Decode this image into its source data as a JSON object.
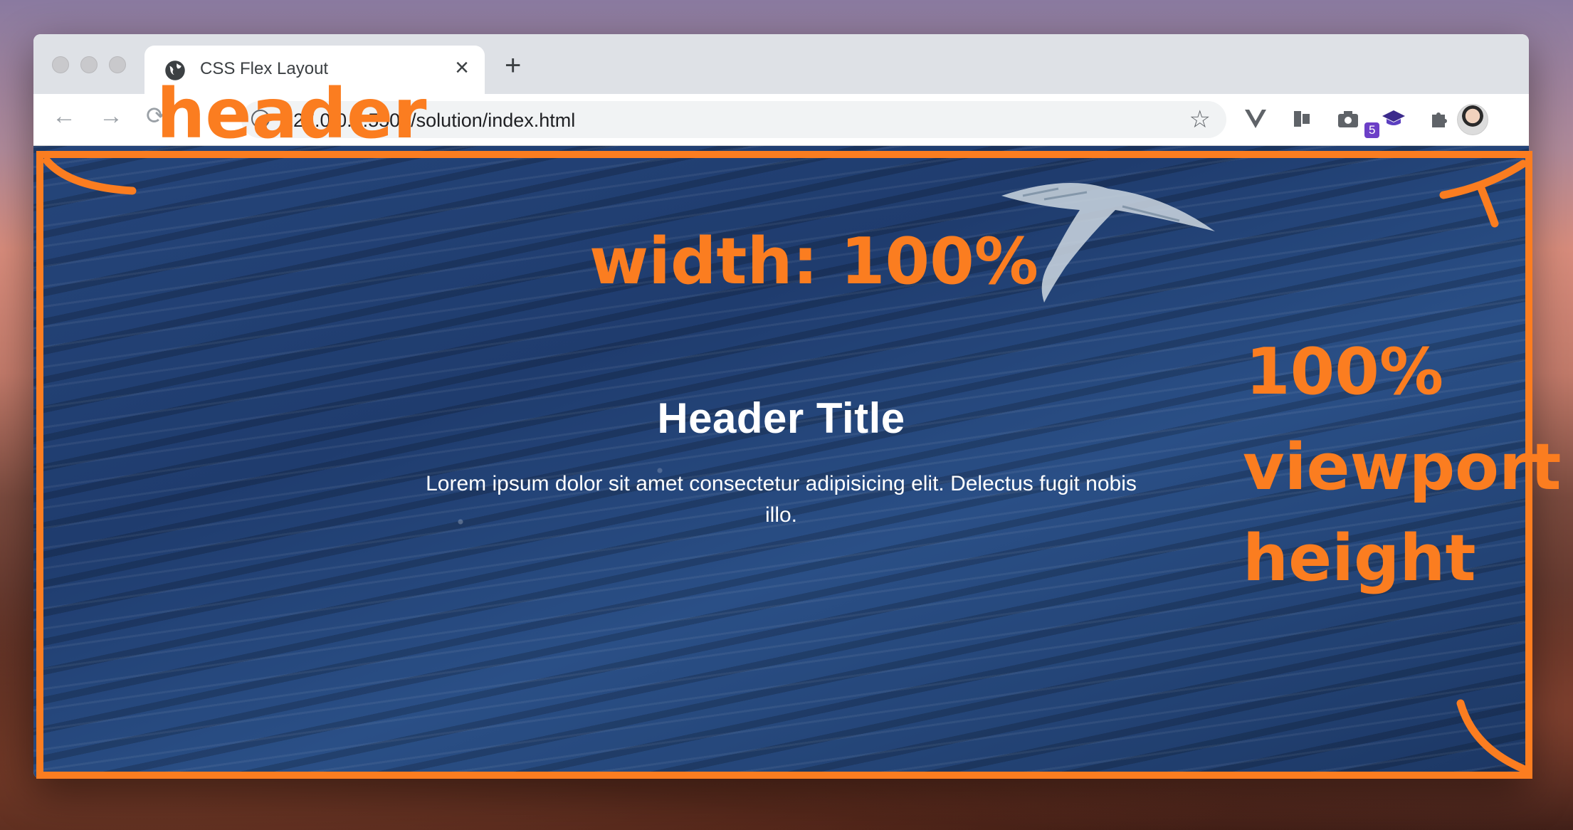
{
  "browser": {
    "tab_title": "CSS Flex Layout",
    "tab_close": "×",
    "new_tab": "+",
    "url": "127.0.0.1:5500/solution/index.html",
    "back": "←",
    "forward": "→",
    "extensions_badge": "5",
    "menu": "⋮"
  },
  "page": {
    "header_title": "Header Title",
    "header_text": "Lorem ipsum dolor sit amet consectetur adipisicing elit. Delectus fugit nobis illo."
  },
  "annotations": {
    "header": "header",
    "width": "width: 100%",
    "height_line1": "100%",
    "height_line2": "viewport",
    "height_line3": "height",
    "color": "#fb7d20"
  }
}
